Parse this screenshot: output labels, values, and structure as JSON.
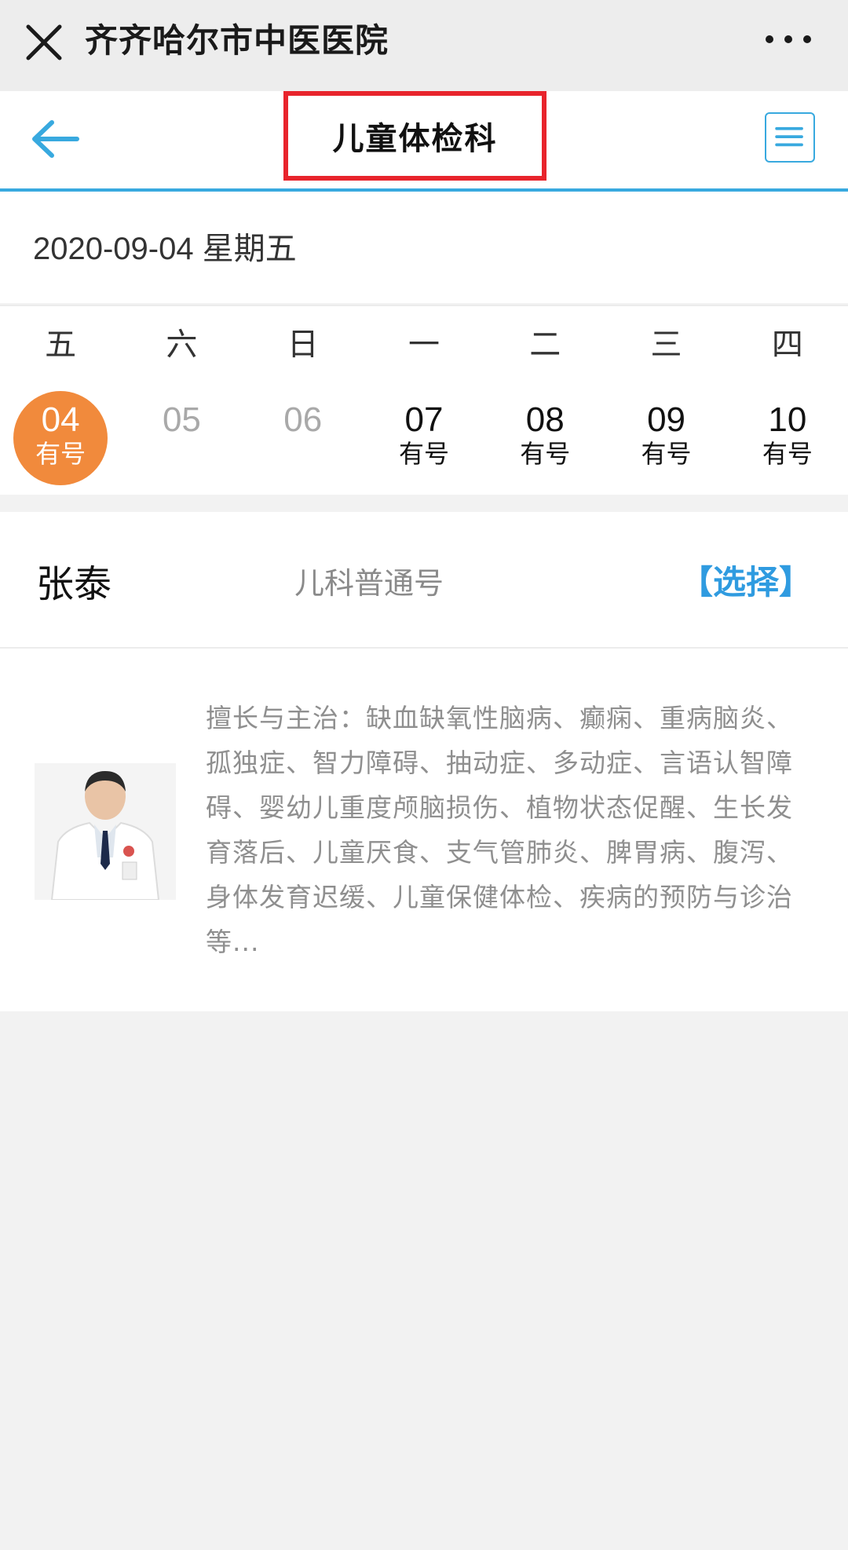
{
  "wechat": {
    "title": "齐齐哈尔市中医医院",
    "close_icon": "close-icon",
    "more_icon": "more-icon"
  },
  "header": {
    "title": "儿童体检科",
    "back_icon": "arrow-left-icon",
    "menu_icon": "menu-icon",
    "accent_color": "#38a9df",
    "highlight_color": "#e8242c"
  },
  "date_line": "2020-09-04 星期五",
  "weekdays": [
    "五",
    "六",
    "日",
    "一",
    "二",
    "三",
    "四"
  ],
  "days": [
    {
      "num": "04",
      "status": "有号",
      "selected": true
    },
    {
      "num": "05",
      "status": "",
      "selected": false
    },
    {
      "num": "06",
      "status": "",
      "selected": false
    },
    {
      "num": "07",
      "status": "有号",
      "selected": false
    },
    {
      "num": "08",
      "status": "有号",
      "selected": false
    },
    {
      "num": "09",
      "status": "有号",
      "selected": false
    },
    {
      "num": "10",
      "status": "有号",
      "selected": false
    }
  ],
  "selected_color": "#f18a3c",
  "doctor": {
    "name": "张泰",
    "type": "儿科普通号",
    "select_label": "【选择】",
    "description": "擅长与主治：缺血缺氧性脑病、癫痫、重病脑炎、 孤独症、智力障碍、抽动症、多动症、言语认智障碍、婴幼儿重度颅脑损伤、植物状态促醒、生长发育落后、儿童厌食、支气管肺炎、脾胃病、腹泻、身体发育迟缓、儿童保健体检、疾病的预防与诊治等..."
  }
}
